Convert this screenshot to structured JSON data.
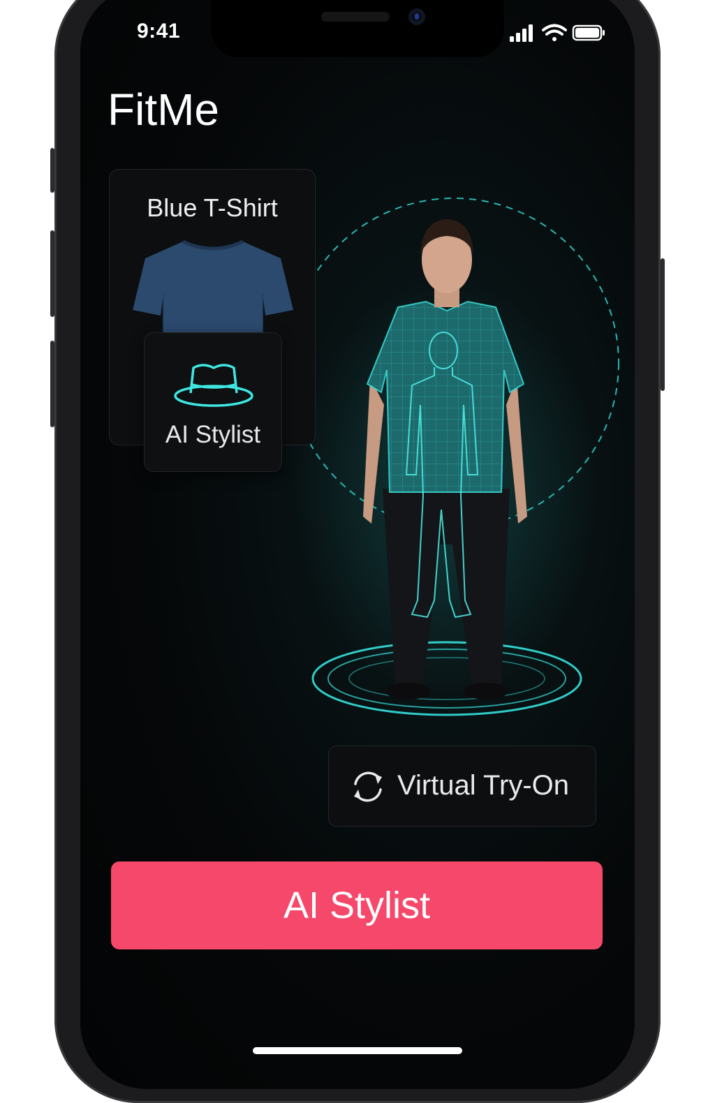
{
  "status_bar": {
    "time": "9:41",
    "icons": [
      "signal-icon",
      "wifi-icon",
      "battery-icon"
    ]
  },
  "app": {
    "title": "FitMe"
  },
  "product_card": {
    "title": "Blue T-Shirt",
    "image_icon": "tshirt-image",
    "shirt_color": "#2c4a6e"
  },
  "stylist_card": {
    "icon": "hat-icon",
    "label": "AI Stylist"
  },
  "preview": {
    "accent_color": "#2fd4d0"
  },
  "tryon_button": {
    "icon": "refresh-icon",
    "label": "Virtual Try-On"
  },
  "cta_button": {
    "label": "AI Stylist",
    "color": "#f5486b"
  }
}
